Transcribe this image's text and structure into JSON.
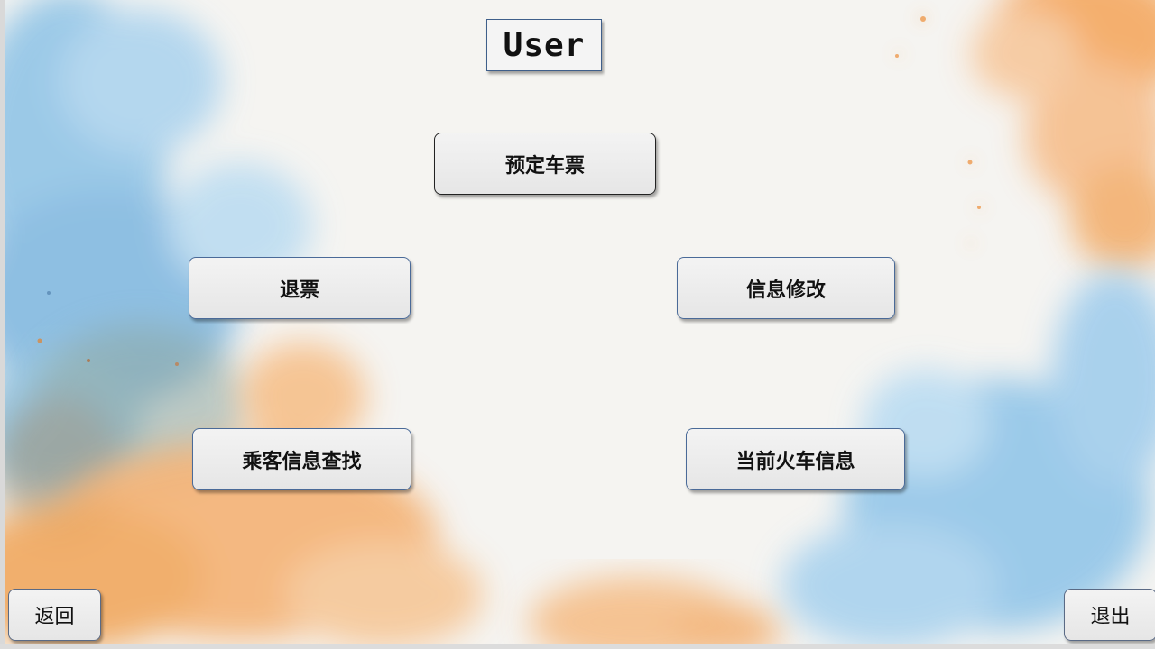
{
  "header": {
    "title": "User"
  },
  "menu": {
    "book_ticket": "预定车票",
    "refund_ticket": "退票",
    "edit_info": "信息修改",
    "passenger_search": "乘客信息查找",
    "current_train_info": "当前火车信息"
  },
  "footer": {
    "back_label": "返回",
    "exit_label": "退出"
  },
  "colors": {
    "watercolor_blue": "#7fb7e0",
    "watercolor_orange": "#f5b06e",
    "button_border_blue": "#4a6a98",
    "button_fill": "#ececec"
  }
}
